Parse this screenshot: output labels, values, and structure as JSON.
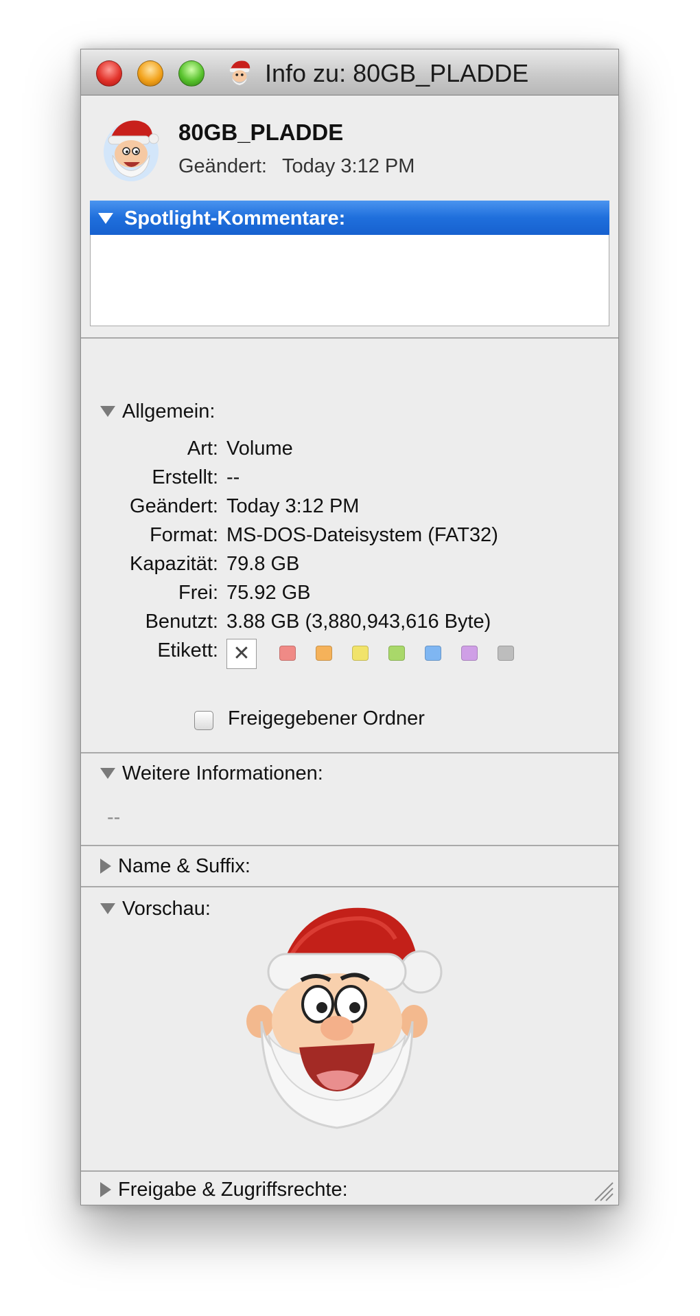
{
  "window": {
    "title": "Info zu: 80GB_PLADDE",
    "controls": {
      "close": "close-button",
      "minimize": "minimize-button",
      "zoom": "zoom-button"
    }
  },
  "header": {
    "name": "80GB_PLADDE",
    "modified_label": "Geändert:",
    "modified_value": "Today 3:12 PM",
    "icon": "santa-face-icon"
  },
  "spotlight": {
    "title": "Spotlight-Kommentare:",
    "comment": ""
  },
  "general": {
    "title": "Allgemein:",
    "rows": [
      {
        "key": "Art:",
        "value": "Volume"
      },
      {
        "key": "Erstellt:",
        "value": "--"
      },
      {
        "key": "Geändert:",
        "value": "Today 3:12 PM"
      },
      {
        "key": "Format:",
        "value": "MS-DOS-Dateisystem (FAT32)"
      },
      {
        "key": "Kapazität:",
        "value": "79.8 GB"
      },
      {
        "key": "Frei:",
        "value": "75.92 GB"
      },
      {
        "key": "Benutzt:",
        "value": "3.88 GB (3,880,943,616 Byte)"
      }
    ],
    "label_key": "Etikett:",
    "label_none": "✕",
    "label_colors": [
      "#f08a86",
      "#f5b25a",
      "#f1e36a",
      "#a9d86a",
      "#7fb6f2",
      "#cf9fe6",
      "#bdbdbd"
    ],
    "shared_folder_label": "Freigegebener Ordner",
    "shared_folder_checked": false
  },
  "more_info": {
    "title": "Weitere Informationen:",
    "value": "--"
  },
  "name_suffix": {
    "title": "Name & Suffix:"
  },
  "preview": {
    "title": "Vorschau:",
    "image": "santa-face-icon"
  },
  "sharing": {
    "title": "Freigabe & Zugriffsrechte:"
  }
}
